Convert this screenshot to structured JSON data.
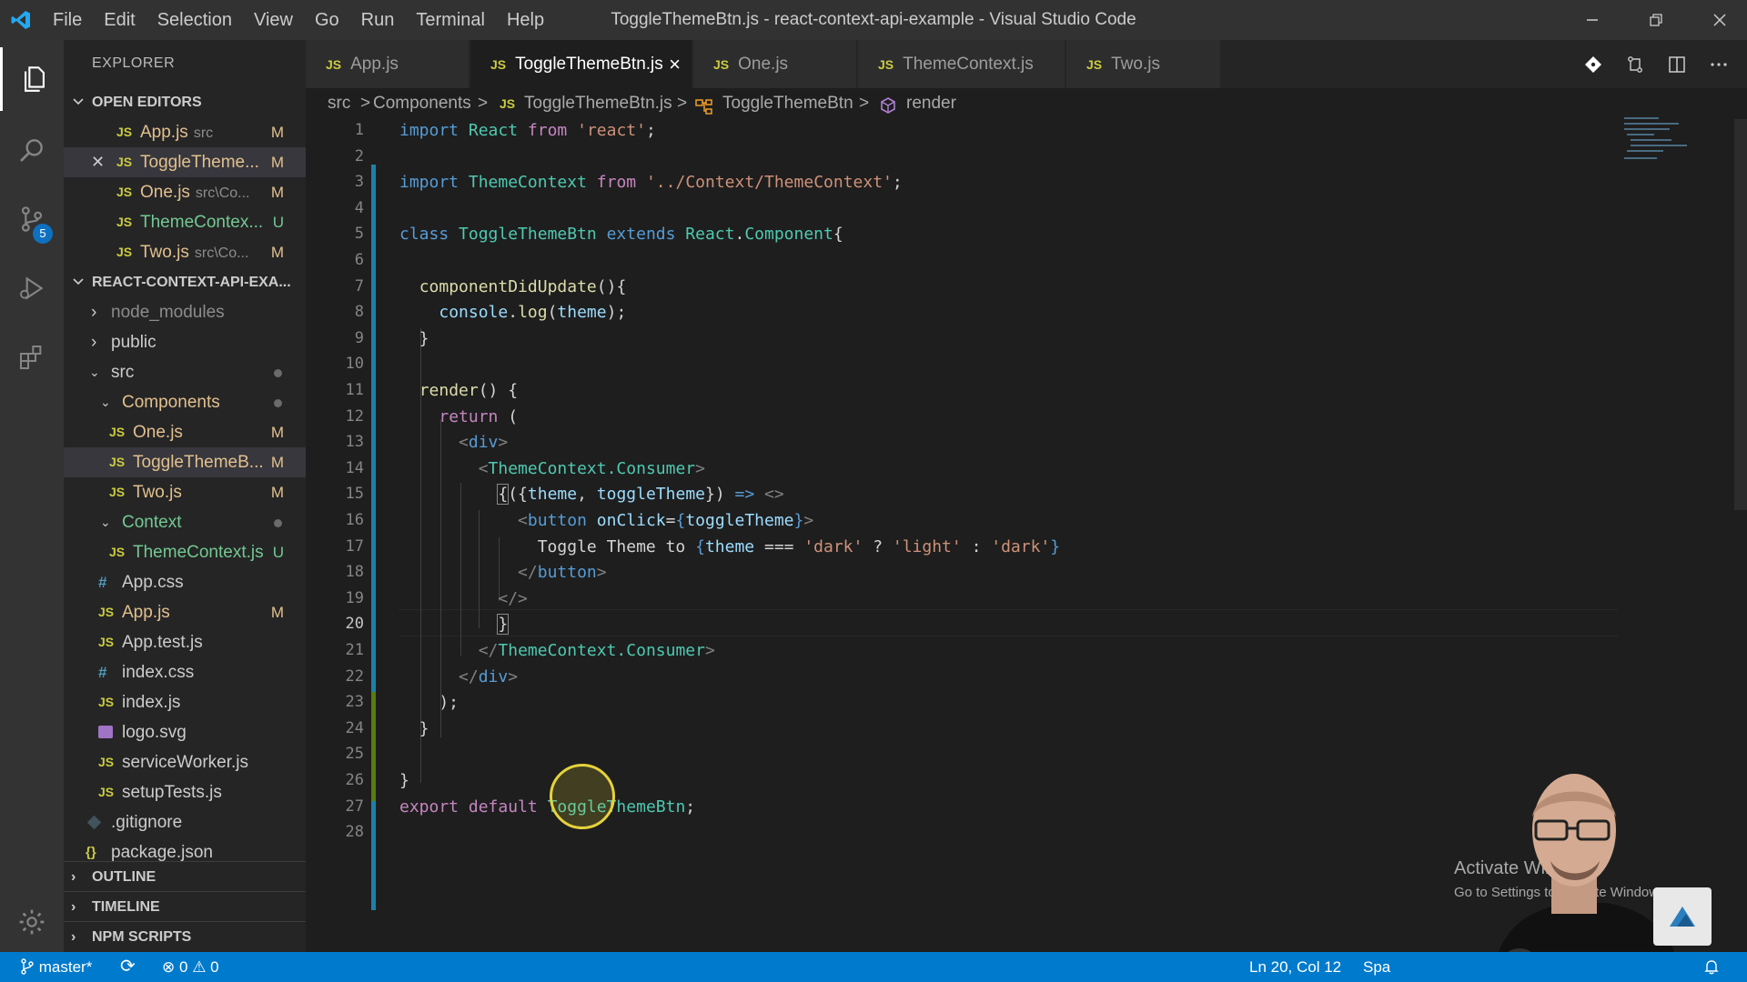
{
  "window": {
    "title": "ToggleThemeBtn.js - react-context-api-example - Visual Studio Code",
    "menu": [
      "File",
      "Edit",
      "Selection",
      "View",
      "Go",
      "Run",
      "Terminal",
      "Help"
    ]
  },
  "activity_bar": {
    "items": [
      "explorer-icon",
      "search-icon",
      "source-control-icon",
      "run-debug-icon",
      "extensions-icon"
    ],
    "scm_badge": "5"
  },
  "sidebar": {
    "title": "EXPLORER",
    "open_editors_header": "OPEN EDITORS",
    "open_editors": [
      {
        "icon": "JS",
        "name": "App.js",
        "path": "src",
        "status": "M"
      },
      {
        "icon": "JS",
        "name": "ToggleTheme...",
        "path": "",
        "status": "M"
      },
      {
        "icon": "JS",
        "name": "One.js",
        "path": "src\\Co...",
        "status": "M"
      },
      {
        "icon": "JS",
        "name": "ThemeContex...",
        "path": "",
        "status": "U"
      },
      {
        "icon": "JS",
        "name": "Two.js",
        "path": "src\\Co...",
        "status": "M"
      }
    ],
    "project_header": "REACT-CONTEXT-API-EXA...",
    "tree": [
      {
        "name": "node_modules",
        "icon": ">",
        "status": ""
      },
      {
        "name": "public",
        "icon": ">",
        "status": ""
      },
      {
        "name": "src",
        "icon": "v",
        "status": ""
      },
      {
        "name": "Components",
        "icon": "v",
        "status": ""
      },
      {
        "name": "One.js",
        "icon": "JS",
        "status": "M"
      },
      {
        "name": "ToggleThemeB...",
        "icon": "JS",
        "status": "M"
      },
      {
        "name": "Two.js",
        "icon": "JS",
        "status": "M"
      },
      {
        "name": "Context",
        "icon": "v",
        "status": ""
      },
      {
        "name": "ThemeContext.js",
        "icon": "JS",
        "status": "U"
      },
      {
        "name": "App.css",
        "icon": "#",
        "status": ""
      },
      {
        "name": "App.js",
        "icon": "JS",
        "status": "M"
      },
      {
        "name": "App.test.js",
        "icon": "JS",
        "status": ""
      },
      {
        "name": "index.css",
        "icon": "#",
        "status": ""
      },
      {
        "name": "index.js",
        "icon": "JS",
        "status": ""
      },
      {
        "name": "logo.svg",
        "icon": "svg",
        "status": ""
      },
      {
        "name": "serviceWorker.js",
        "icon": "JS",
        "status": ""
      },
      {
        "name": "setupTests.js",
        "icon": "JS",
        "status": ""
      },
      {
        "name": ".gitignore",
        "icon": "git",
        "status": ""
      },
      {
        "name": "package.json",
        "icon": "{}",
        "status": ""
      }
    ],
    "outline": "OUTLINE",
    "timeline": "TIMELINE",
    "npm_scripts": "NPM SCRIPTS"
  },
  "tabs": [
    {
      "icon": "JS",
      "label": "App.js"
    },
    {
      "icon": "JS",
      "label": "ToggleThemeBtn.js",
      "close": "×"
    },
    {
      "icon": "JS",
      "label": "One.js"
    },
    {
      "icon": "JS",
      "label": "ThemeContext.js"
    },
    {
      "icon": "JS",
      "label": "Two.js"
    }
  ],
  "breadcrumb": [
    "src",
    ">",
    "Components",
    ">",
    "JS",
    "ToggleThemeBtn.js",
    ">",
    "ToggleThemeBtn",
    ">",
    "render"
  ],
  "editor": {
    "line_numbers": [
      "1",
      "2",
      "3",
      "4",
      "5",
      "6",
      "7",
      "8",
      "9",
      "10",
      "11",
      "12",
      "13",
      "14",
      "15",
      "16",
      "17",
      "18",
      "19",
      "20",
      "21",
      "22",
      "23",
      "24",
      "25",
      "26",
      "27",
      "28"
    ],
    "lines": [
      [
        [
          "k",
          "import"
        ],
        [
          "o",
          " "
        ],
        [
          "c",
          "React"
        ],
        [
          "o",
          " "
        ],
        [
          "kc",
          "from"
        ],
        [
          "o",
          " "
        ],
        [
          "s",
          "'react'"
        ],
        [
          "o",
          ";"
        ]
      ],
      [],
      [
        [
          "k",
          "import"
        ],
        [
          "o",
          " "
        ],
        [
          "c",
          "ThemeContext"
        ],
        [
          "o",
          " "
        ],
        [
          "kc",
          "from"
        ],
        [
          "o",
          " "
        ],
        [
          "s",
          "'../Context/ThemeContext'"
        ],
        [
          "o",
          ";"
        ]
      ],
      [],
      [
        [
          "k",
          "class"
        ],
        [
          "o",
          " "
        ],
        [
          "c",
          "ToggleThemeBtn"
        ],
        [
          "o",
          " "
        ],
        [
          "k",
          "extends"
        ],
        [
          "o",
          " "
        ],
        [
          "c",
          "React"
        ],
        [
          "o",
          "."
        ],
        [
          "c",
          "Component"
        ],
        [
          "o",
          "{"
        ]
      ],
      [],
      [
        [
          "o",
          "  "
        ],
        [
          "f",
          "componentDidUpdate"
        ],
        [
          "o",
          "(){"
        ]
      ],
      [
        [
          "o",
          "    "
        ],
        [
          "v",
          "console"
        ],
        [
          "o",
          "."
        ],
        [
          "f",
          "log"
        ],
        [
          "o",
          "("
        ],
        [
          "v",
          "theme"
        ],
        [
          "o",
          ");"
        ]
      ],
      [
        [
          "o",
          "  }"
        ]
      ],
      [],
      [
        [
          "o",
          "  "
        ],
        [
          "f",
          "render"
        ],
        [
          "o",
          "() {"
        ]
      ],
      [
        [
          "o",
          "    "
        ],
        [
          "kc",
          "return"
        ],
        [
          "o",
          " ("
        ]
      ],
      [
        [
          "o",
          "      "
        ],
        [
          "t",
          "<"
        ],
        [
          "tg",
          "div"
        ],
        [
          "t",
          ">"
        ]
      ],
      [
        [
          "o",
          "        "
        ],
        [
          "t",
          "<"
        ],
        [
          "c",
          "ThemeContext.Consumer"
        ],
        [
          "t",
          ">"
        ]
      ],
      [
        [
          "o",
          "          "
        ],
        [
          "brk",
          "{"
        ],
        [
          "o",
          "({"
        ],
        [
          "v",
          "theme"
        ],
        [
          "o",
          ", "
        ],
        [
          "v",
          "toggleTheme"
        ],
        [
          "o",
          "}) "
        ],
        [
          "k",
          "=>"
        ],
        [
          "o",
          " "
        ],
        [
          "t",
          "<>"
        ]
      ],
      [
        [
          "o",
          "            "
        ],
        [
          "t",
          "<"
        ],
        [
          "tg",
          "button"
        ],
        [
          "o",
          " "
        ],
        [
          "v",
          "onClick"
        ],
        [
          "o",
          "="
        ],
        [
          "k",
          "{"
        ],
        [
          "v",
          "toggleTheme"
        ],
        [
          "k",
          "}"
        ],
        [
          "t",
          ">"
        ]
      ],
      [
        [
          "o",
          "              Toggle Theme to "
        ],
        [
          "k",
          "{"
        ],
        [
          "v",
          "theme"
        ],
        [
          "o",
          " === "
        ],
        [
          "s",
          "'dark'"
        ],
        [
          "o",
          " ? "
        ],
        [
          "s",
          "'light'"
        ],
        [
          "o",
          " : "
        ],
        [
          "s",
          "'dark'"
        ],
        [
          "k",
          "}"
        ]
      ],
      [
        [
          "o",
          "            "
        ],
        [
          "t",
          "</"
        ],
        [
          "tg",
          "button"
        ],
        [
          "t",
          ">"
        ]
      ],
      [
        [
          "o",
          "          "
        ],
        [
          "t",
          "</>"
        ]
      ],
      [
        [
          "o",
          "          "
        ],
        [
          "brk",
          "}"
        ]
      ],
      [
        [
          "o",
          "        "
        ],
        [
          "t",
          "</"
        ],
        [
          "c",
          "ThemeContext.Consumer"
        ],
        [
          "t",
          ">"
        ]
      ],
      [
        [
          "o",
          "      "
        ],
        [
          "t",
          "</"
        ],
        [
          "tg",
          "div"
        ],
        [
          "t",
          ">"
        ]
      ],
      [
        [
          "o",
          "    );"
        ]
      ],
      [
        [
          "o",
          "  }"
        ]
      ],
      [],
      [
        [
          "o",
          "}"
        ]
      ],
      [
        [
          "kc",
          "export"
        ],
        [
          "o",
          " "
        ],
        [
          "kc",
          "default"
        ],
        [
          "o",
          " "
        ],
        [
          "c",
          "ToggleThemeBtn"
        ],
        [
          "o",
          ";"
        ]
      ],
      []
    ]
  },
  "statusbar": {
    "branch": "master*",
    "sync": "⟳",
    "errors": "0",
    "warnings": "0",
    "position": "Ln 20, Col 12",
    "spaces": "Spa"
  },
  "watermark": {
    "line1": "Activate Windows",
    "line2": "Go to Settings to activate Windows."
  },
  "colors": {
    "accent": "#007acc",
    "modified": "#e2c08d",
    "untracked": "#73c991",
    "js_icon": "#cbcb41"
  }
}
